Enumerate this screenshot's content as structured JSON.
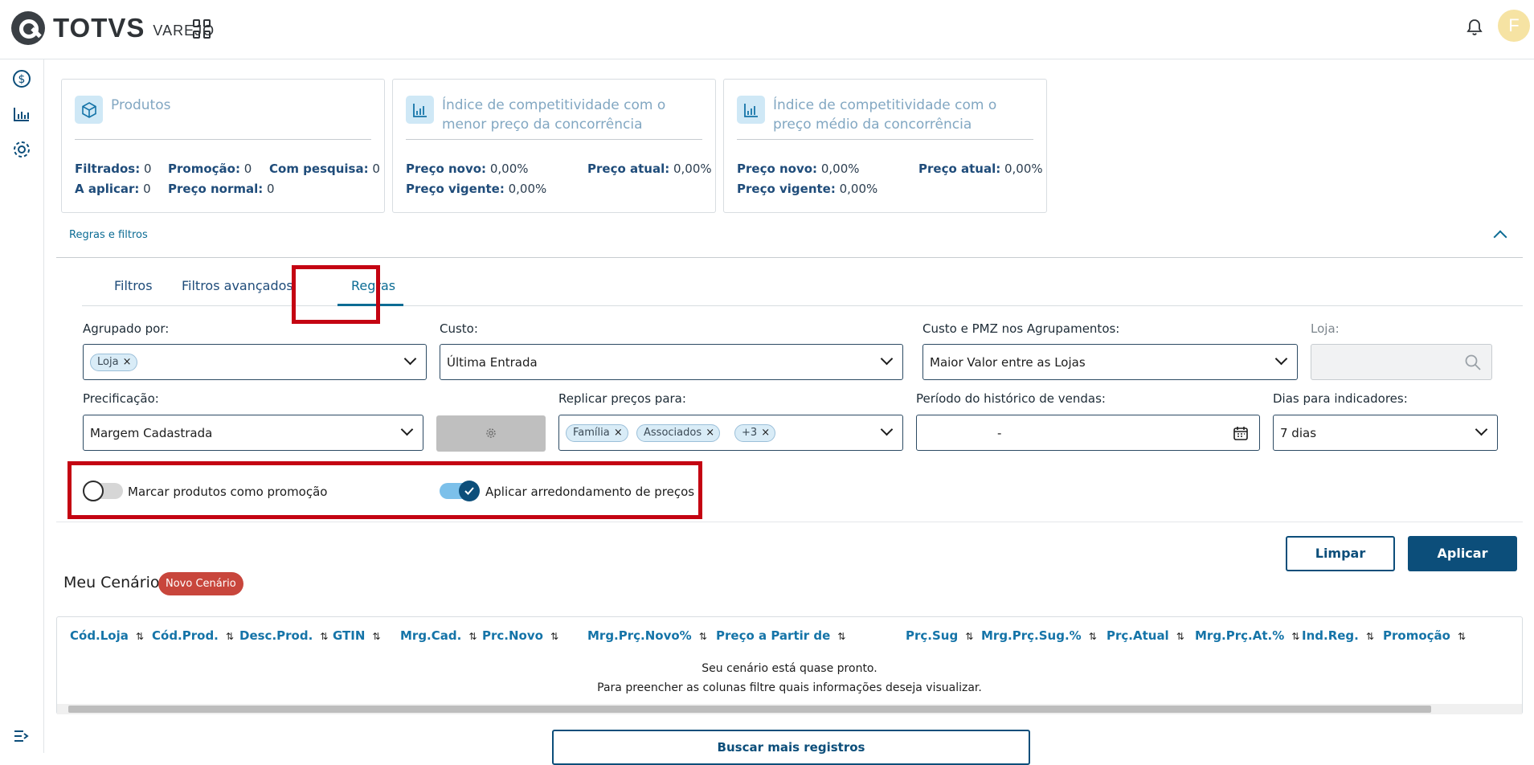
{
  "app": {
    "brand": "TOTVS",
    "brand_sub": "VAREJO",
    "avatar_letter": "F",
    "accent": "#0c4e7a",
    "badge_color": "#c8463c"
  },
  "cards": [
    {
      "title": "Produtos",
      "icon": "cube-icon",
      "stats": [
        {
          "label": "Filtrados:",
          "value": "0"
        },
        {
          "label": "Promoção:",
          "value": "0"
        },
        {
          "label": "Com pesquisa:",
          "value": "0"
        },
        {
          "label": "A aplicar:",
          "value": "0"
        },
        {
          "label": "Preço normal:",
          "value": "0"
        }
      ]
    },
    {
      "title": "Índice de competitividade com o menor preço da concorrência",
      "icon": "bar-chart-icon",
      "stats": [
        {
          "label": "Preço novo:",
          "value": "0,00%"
        },
        {
          "label": "Preço atual:",
          "value": "0,00%"
        },
        {
          "label": "Preço vigente:",
          "value": "0,00%"
        }
      ]
    },
    {
      "title": "Índice de competitividade com o preço médio da concorrência",
      "icon": "bar-chart-icon",
      "stats": [
        {
          "label": "Preço novo:",
          "value": "0,00%"
        },
        {
          "label": "Preço atual:",
          "value": "0,00%"
        },
        {
          "label": "Preço vigente:",
          "value": "0,00%"
        }
      ]
    }
  ],
  "section": {
    "title": "Regras e filtros"
  },
  "tabs": [
    {
      "label": "Filtros"
    },
    {
      "label": "Filtros avançados"
    },
    {
      "label": "Regras",
      "active": true
    }
  ],
  "form": {
    "agrupado": {
      "label": "Agrupado por:",
      "chips": [
        "Loja"
      ]
    },
    "custo": {
      "label": "Custo:",
      "value": "Última Entrada"
    },
    "custo_pmz": {
      "label": "Custo e PMZ nos Agrupamentos:",
      "value": "Maior Valor entre as Lojas"
    },
    "loja": {
      "label": "Loja:",
      "value": ""
    },
    "precificacao": {
      "label": "Precificação:",
      "value": "Margem Cadastrada"
    },
    "replicar": {
      "label": "Replicar preços para:",
      "chips": [
        "Família",
        "Associados",
        "+3"
      ]
    },
    "periodo": {
      "label": "Período do histórico de vendas:",
      "value": "-"
    },
    "dias": {
      "label": "Dias para indicadores:",
      "value": "7 dias"
    }
  },
  "toggles": [
    {
      "label": "Marcar produtos como promoção",
      "on": false
    },
    {
      "label": "Aplicar arredondamento de preços",
      "on": true
    }
  ],
  "actions": {
    "clear": "Limpar",
    "apply": "Aplicar"
  },
  "scenario": {
    "title": "Meu Cenário",
    "badge": "Novo Cenário"
  },
  "table": {
    "columns": [
      "Cód.Loja",
      "Cód.Prod.",
      "Desc.Prod.",
      "GTIN",
      "Mrg.Cad.",
      "Prc.Novo",
      "Mrg.Prç.Novo%",
      "Preço a Partir de",
      "Prç.Sug",
      "Mrg.Prç.Sug.%",
      "Prç.Atual",
      "Mrg.Prç.At.%",
      "Ind.Reg.",
      "Promoção"
    ],
    "empty_line1": "Seu cenário está quase pronto.",
    "empty_line2": "Para preencher as colunas filtre quais informações deseja visualizar."
  },
  "load_more": "Buscar mais registros"
}
